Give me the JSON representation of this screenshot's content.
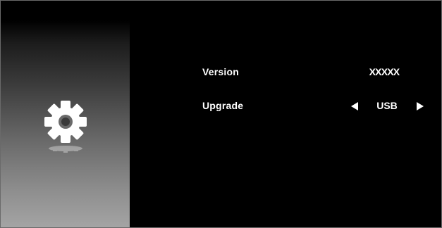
{
  "sidebar": {
    "icon": "gear-icon"
  },
  "settings": {
    "version": {
      "label": "Version",
      "value": "XXXXX"
    },
    "upgrade": {
      "label": "Upgrade",
      "value": "USB",
      "prev_icon": "arrow-left-icon",
      "next_icon": "arrow-right-icon"
    }
  },
  "colors": {
    "background": "#000000",
    "text": "#ffffff",
    "sidebar_gradient_end": "#a4a4a4",
    "border": "#6a6a6a"
  }
}
